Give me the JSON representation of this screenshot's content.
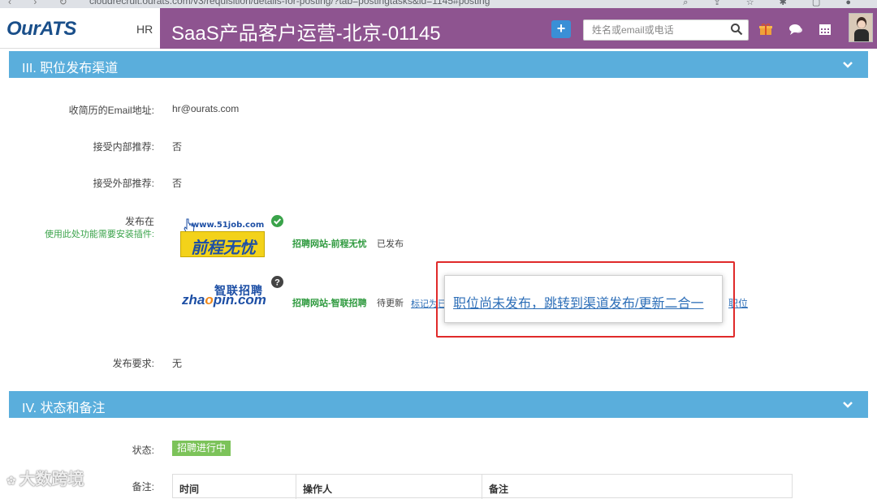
{
  "browser": {
    "url": "cloudrecruit.ourats.com/v3/requisition/details-for-posting/?tab=postingtasks&id=1145#posting"
  },
  "header": {
    "logo": "OurATS",
    "role_label": "HR",
    "page_title": "SaaS产品客户运营-北京-01145",
    "add_button": "+",
    "search_placeholder": "姓名或email或电话",
    "accent_color": "#8e5490",
    "icons": [
      "gift-icon",
      "chat-icon",
      "calendar-icon"
    ]
  },
  "section3": {
    "title": "III. 职位发布渠道",
    "rows": {
      "email_label": "收简历的Email地址:",
      "email_value": "hr@ourats.com",
      "internal_label": "接受内部推荐:",
      "internal_value": "否",
      "external_label": "接受外部推荐:",
      "external_value": "否",
      "publish_label": "发布在",
      "plugin_note": "使用此处功能需要安装插件:",
      "requirement_label": "发布要求:",
      "requirement_value": "无"
    },
    "channels": [
      {
        "logo_url": "www.51job.com",
        "logo_text": "前程无忧",
        "name": "招聘网站-前程无忧",
        "status": "已发布",
        "status_icon": "check-circle-icon"
      },
      {
        "logo_cn": "智联招聘",
        "logo_en_pre": "zha",
        "logo_en_o": "o",
        "logo_en_post": "pin.com",
        "name": "招聘网站-智联招聘",
        "status": "待更新",
        "status_icon": "question-circle-icon",
        "mark_link": "标记为已",
        "tail_link": "职位"
      }
    ],
    "tooltip": "职位尚未发布，跳转到渠道发布/更新二合一"
  },
  "section4": {
    "title": "IV. 状态和备注",
    "status_label": "状态:",
    "status_value": "招聘进行中",
    "notes_label": "备注:",
    "table_headers": [
      "时间",
      "操作人",
      "备注"
    ]
  },
  "watermark": "大数跨境"
}
